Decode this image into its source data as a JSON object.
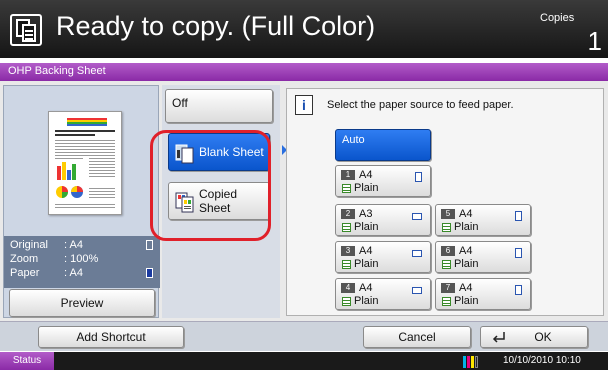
{
  "header": {
    "title": "Ready to copy. (Full Color)",
    "copies_label": "Copies",
    "copies_count": "1"
  },
  "function_title": "OHP Backing Sheet",
  "preview": {
    "original_label": "Original",
    "original_value": ": A4",
    "zoom_label": "Zoom",
    "zoom_value": ": 100%",
    "paper_label": "Paper",
    "paper_value": ": A4",
    "preview_button": "Preview"
  },
  "options": {
    "off": "Off",
    "blank_sheet": "Blank Sheet",
    "copied_sheet_line1": "Copied",
    "copied_sheet_line2": "Sheet",
    "selected": "Blank Sheet"
  },
  "paper_source": {
    "message": "Select the paper source to feed paper.",
    "auto": "Auto",
    "trays": [
      {
        "num": "1",
        "size": "A4",
        "type": "Plain",
        "orientation": "portrait"
      },
      {
        "num": "2",
        "size": "A3",
        "type": "Plain",
        "orientation": "landscape"
      },
      {
        "num": "3",
        "size": "A4",
        "type": "Plain",
        "orientation": "landscape"
      },
      {
        "num": "4",
        "size": "A4",
        "type": "Plain",
        "orientation": "landscape"
      },
      {
        "num": "5",
        "size": "A4",
        "type": "Plain",
        "orientation": "portrait"
      },
      {
        "num": "6",
        "size": "A4",
        "type": "Plain",
        "orientation": "portrait"
      },
      {
        "num": "7",
        "size": "A4",
        "type": "Plain",
        "orientation": "portrait"
      }
    ]
  },
  "footer": {
    "add_shortcut": "Add Shortcut",
    "cancel": "Cancel",
    "ok": "OK"
  },
  "status_bar": {
    "status": "Status",
    "datetime": "10/10/2010  10:10"
  },
  "colors": {
    "accent_purple": "#9b3bb8",
    "selected_blue": "#1a66e0",
    "highlight_ring": "#e0202a"
  }
}
